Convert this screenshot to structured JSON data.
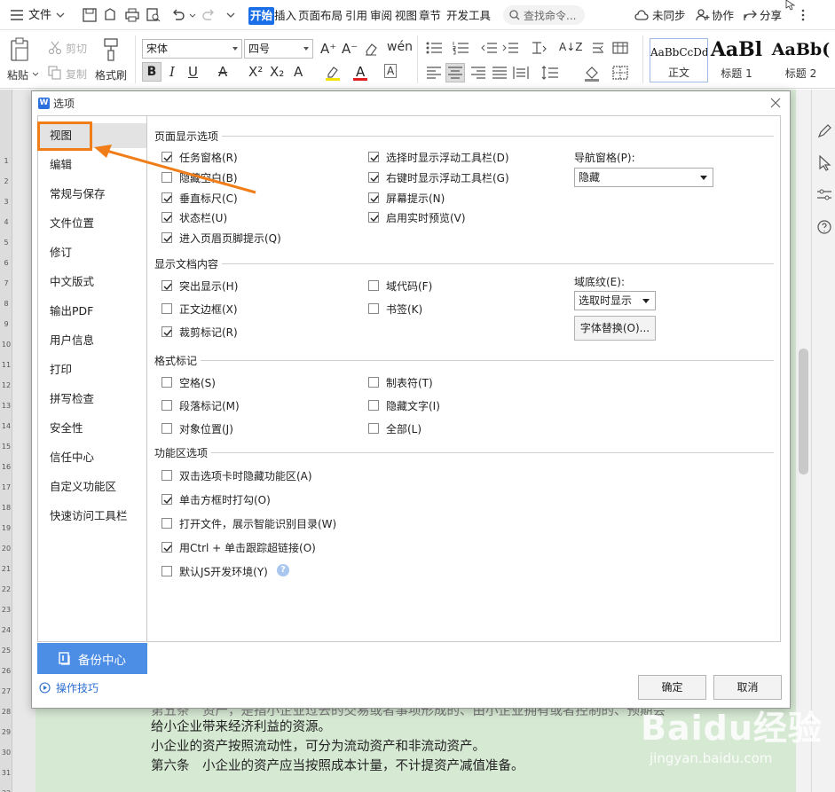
{
  "menubar": {
    "file_label": "文件",
    "tabs": [
      {
        "label": "开始",
        "active": true
      },
      {
        "label": "插入"
      },
      {
        "label": "页面布局"
      },
      {
        "label": "引用"
      },
      {
        "label": "审阅"
      },
      {
        "label": "视图"
      },
      {
        "label": "章节"
      },
      {
        "label": "开发工具"
      }
    ],
    "search_placeholder": "查找命令...",
    "sync_label": "未同步",
    "collab_label": "协作",
    "share_label": "分享"
  },
  "ribbon": {
    "paste_label": "粘贴",
    "cut_label": "剪切",
    "copy_label": "复制",
    "format_painter_label": "格式刷",
    "font_name": "宋体",
    "font_size": "四号",
    "styles": [
      {
        "sample": "AaBbCcDd",
        "name": "正文"
      },
      {
        "sample": "AaBl",
        "name": "标题 1"
      },
      {
        "sample": "AaBb(",
        "name": "标题 2"
      }
    ]
  },
  "document": {
    "ruler_numbers": [
      "1",
      "2",
      "3",
      "4",
      "5",
      "6",
      "7",
      "8",
      "9",
      "10",
      "11",
      "12",
      "13",
      "14",
      "15",
      "16",
      "17",
      "18",
      "19",
      "20",
      "21",
      "22",
      "23",
      "24",
      "25",
      "26",
      "27",
      "28",
      "29",
      "30",
      "31",
      "32",
      "33"
    ],
    "lines": [
      "第五条　资产，是指小企业过去的交易或者事项形成的、由小企业拥有或者控制的、预期会",
      "给小企业带来经济利益的资源。",
      "小企业的资产按照流动性，可分为流动资产和非流动资产。",
      "第六条　小企业的资产应当按照成本计量，不计提资产减值准备。"
    ]
  },
  "dialog": {
    "title": "选项",
    "sidebar": [
      {
        "label": "视图",
        "selected": true
      },
      {
        "label": "编辑"
      },
      {
        "label": "常规与保存"
      },
      {
        "label": "文件位置"
      },
      {
        "label": "修订"
      },
      {
        "label": "中文版式"
      },
      {
        "label": "输出PDF"
      },
      {
        "label": "用户信息"
      },
      {
        "label": "打印"
      },
      {
        "label": "拼写检查"
      },
      {
        "label": "安全性"
      },
      {
        "label": "信任中心"
      },
      {
        "label": "自定义功能区"
      },
      {
        "label": "快速访问工具栏"
      }
    ],
    "backup_label": "备份中心",
    "tips_label": "操作技巧",
    "sections": {
      "page_display": {
        "title": "页面显示选项",
        "col1": [
          {
            "label": "任务窗格(R)",
            "checked": true
          },
          {
            "label": "隐藏空白(B)",
            "checked": false
          },
          {
            "label": "垂直标尺(C)",
            "checked": true
          },
          {
            "label": "状态栏(U)",
            "checked": true
          },
          {
            "label": "进入页眉页脚提示(Q)",
            "checked": true
          }
        ],
        "col2": [
          {
            "label": "选择时显示浮动工具栏(D)",
            "checked": true
          },
          {
            "label": "右键时显示浮动工具栏(G)",
            "checked": true
          },
          {
            "label": "屏幕提示(N)",
            "checked": true
          },
          {
            "label": "启用实时预览(V)",
            "checked": true
          }
        ],
        "nav_pane_label": "导航窗格(P):",
        "nav_pane_value": "隐藏"
      },
      "doc_content": {
        "title": "显示文档内容",
        "col1": [
          {
            "label": "突出显示(H)",
            "checked": true
          },
          {
            "label": "正文边框(X)",
            "checked": false
          },
          {
            "label": "裁剪标记(R)",
            "checked": true
          }
        ],
        "col2": [
          {
            "label": "域代码(F)",
            "checked": false
          },
          {
            "label": "书签(K)",
            "checked": false
          }
        ],
        "field_shading_label": "域底纹(E):",
        "field_shading_value": "选取时显示",
        "font_sub_button": "字体替换(O)..."
      },
      "format_marks": {
        "title": "格式标记",
        "col1": [
          {
            "label": "空格(S)",
            "checked": false
          },
          {
            "label": "段落标记(M)",
            "checked": false
          },
          {
            "label": "对象位置(J)",
            "checked": false
          }
        ],
        "col2": [
          {
            "label": "制表符(T)",
            "checked": false
          },
          {
            "label": "隐藏文字(I)",
            "checked": false
          },
          {
            "label": "全部(L)",
            "checked": false
          }
        ]
      },
      "ribbon_opts": {
        "title": "功能区选项",
        "items": [
          {
            "label": "双击选项卡时隐藏功能区(A)",
            "checked": false
          },
          {
            "label": "单击方框时打勾(O)",
            "checked": true
          },
          {
            "label": "打开文件，展示智能识别目录(W)",
            "checked": false
          },
          {
            "label": "用Ctrl + 单击跟踪超链接(O)",
            "checked": true
          },
          {
            "label": "默认JS开发环境(Y)",
            "checked": false
          }
        ],
        "help_glyph": "?"
      }
    },
    "ok_label": "确定",
    "cancel_label": "取消"
  },
  "watermark": {
    "text": "Baidu经验",
    "url": "jingyan.baidu.com"
  },
  "colors": {
    "accent": "#1a6fe8",
    "annotation": "#f07d17",
    "backup_bg": "#4c8ee6",
    "page_bg": "#d6e9d3"
  }
}
